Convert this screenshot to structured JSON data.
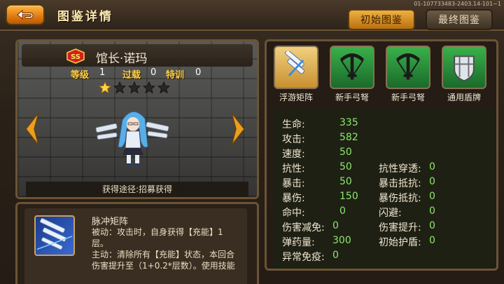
{
  "header": {
    "title": "图鉴详情",
    "version": "01-107733483-2403.14-101~1",
    "tabs": [
      {
        "label": "初始图鉴",
        "active": true
      },
      {
        "label": "最终图鉴",
        "active": false
      }
    ]
  },
  "hero": {
    "name": "馆长·诺玛",
    "rank_badge": "SS",
    "level_label": "等级",
    "level_value": "1",
    "overload_label": "过载",
    "overload_value": "0",
    "training_label": "特训",
    "training_value": "0",
    "stars_filled": 1,
    "stars_total": 5,
    "source": "获得途径:招募获得"
  },
  "skill": {
    "name": "脉冲矩阵",
    "line1": "被动：攻击时，自身获得【充能】1",
    "line2": "层。",
    "line3": "主动：清除所有【充能】状态，本回合",
    "line4": "伤害提升至（1+0.2*层数）。使用技能"
  },
  "equipment": [
    {
      "label": "浮游矩阵",
      "icon": "floating-matrix-icon",
      "frame": "#c89030"
    },
    {
      "label": "新手弓弩",
      "icon": "crossbow-icon",
      "frame": "#2a8a3a"
    },
    {
      "label": "新手弓弩",
      "icon": "crossbow-icon",
      "frame": "#2a8a3a"
    },
    {
      "label": "通用盾牌",
      "icon": "shield-icon",
      "frame": "#2a8a3a"
    }
  ],
  "attributes_left": [
    {
      "k": "生命:",
      "v": "335"
    },
    {
      "k": "攻击:",
      "v": "582"
    },
    {
      "k": "速度:",
      "v": "50"
    },
    {
      "k": "抗性:",
      "v": "50"
    },
    {
      "k": "暴击:",
      "v": "50"
    },
    {
      "k": "暴伤:",
      "v": "150"
    },
    {
      "k": "命中:",
      "v": "0"
    },
    {
      "k": "伤害减免:",
      "v": "0"
    },
    {
      "k": "弹药量:",
      "v": "300"
    },
    {
      "k": "异常免疫:",
      "v": "0"
    }
  ],
  "attributes_right": [
    {
      "k": "抗性穿透:",
      "v": "0"
    },
    {
      "k": "暴击抵抗:",
      "v": "0"
    },
    {
      "k": "暴伤抵抗:",
      "v": "0"
    },
    {
      "k": "闪避:",
      "v": "0"
    },
    {
      "k": "伤害提升:",
      "v": "0"
    },
    {
      "k": "初始护盾:",
      "v": "0"
    }
  ],
  "colors": {
    "gold": "#ffd24a",
    "value_green": "#8ee86a",
    "frame": "#6b5434"
  }
}
